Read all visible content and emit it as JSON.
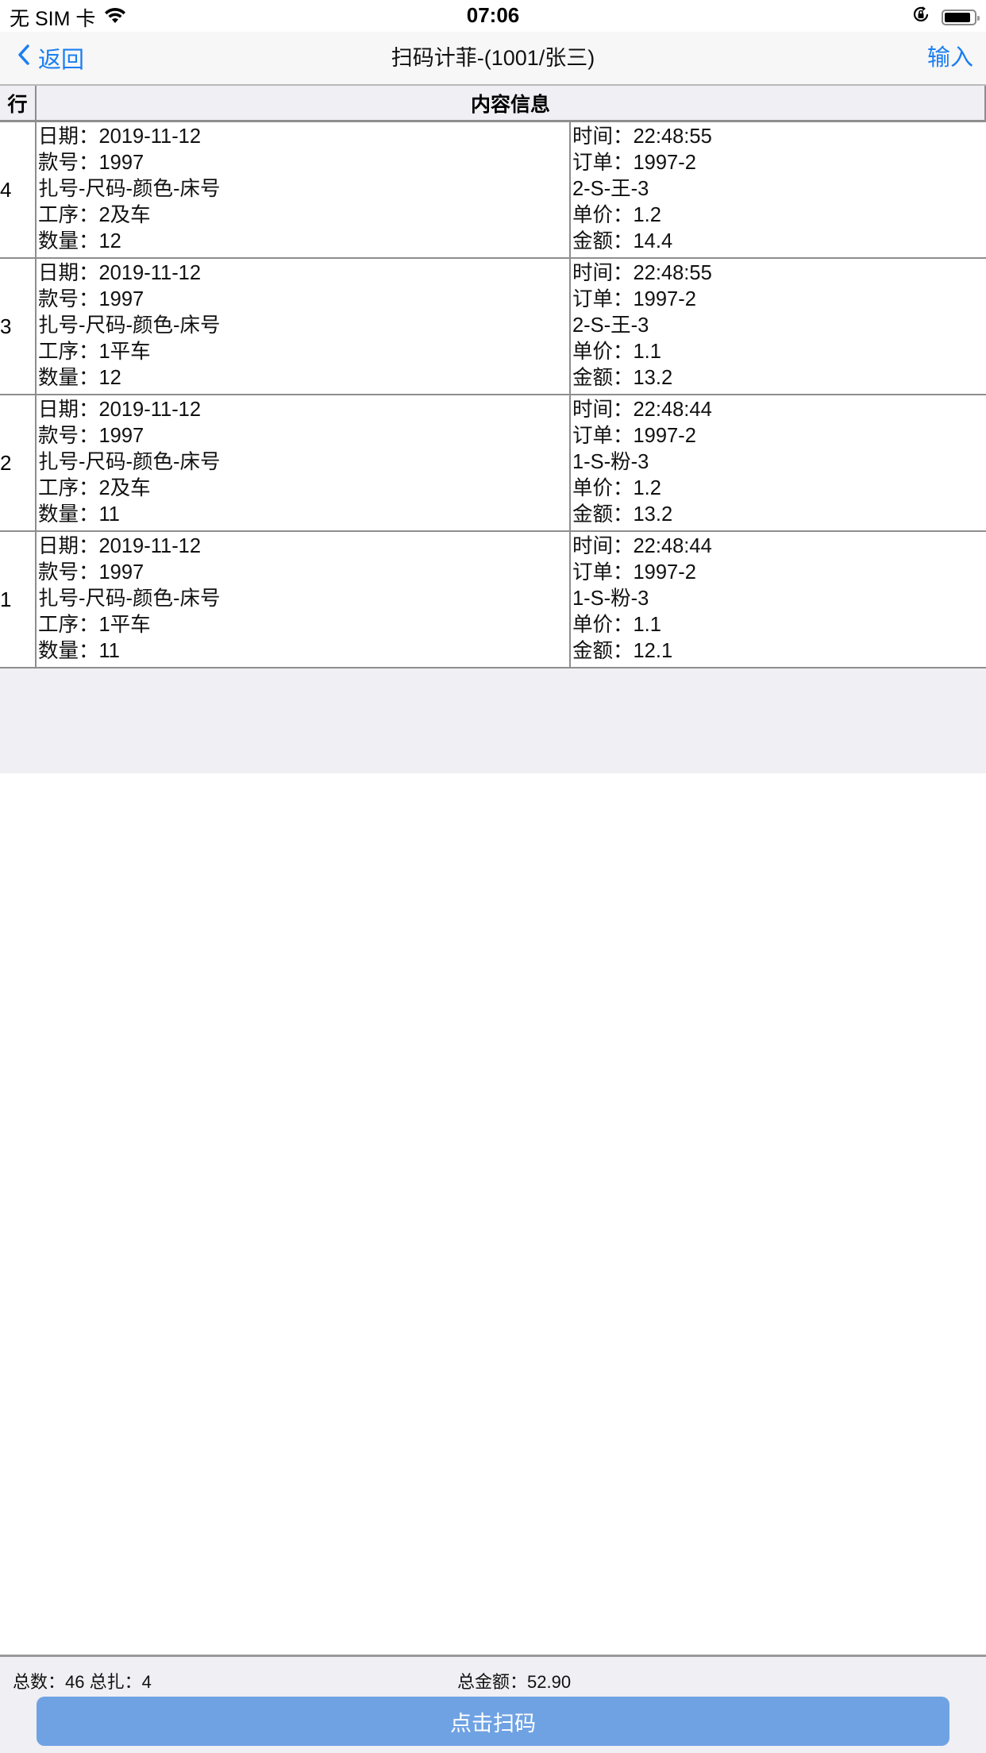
{
  "status_bar": {
    "carrier": "无 SIM 卡",
    "time": "07:06",
    "battery_level": 0.9
  },
  "nav": {
    "back_label": "返回",
    "title": "扫码计菲-(1001/张三)",
    "input_label": "输入"
  },
  "table": {
    "headers": {
      "row": "行",
      "content": "内容信息"
    },
    "rows": [
      {
        "num": "4",
        "left": [
          "日期：2019-11-12",
          "款号：1997",
          "扎号-尺码-颜色-床号",
          "工序：2及车",
          "数量：12"
        ],
        "right": [
          "时间：22:48:55",
          "订单：1997-2",
          "2-S-王-3",
          "单价：1.2",
          "金额：14.4"
        ]
      },
      {
        "num": "3",
        "left": [
          "日期：2019-11-12",
          "款号：1997",
          "扎号-尺码-颜色-床号",
          "工序：1平车",
          "数量：12"
        ],
        "right": [
          "时间：22:48:55",
          "订单：1997-2",
          "2-S-王-3",
          "单价：1.1",
          "金额：13.2"
        ]
      },
      {
        "num": "2",
        "left": [
          "日期：2019-11-12",
          "款号：1997",
          "扎号-尺码-颜色-床号",
          "工序：2及车",
          "数量：11"
        ],
        "right": [
          "时间：22:48:44",
          "订单：1997-2",
          "1-S-粉-3",
          "单价：1.2",
          "金额：13.2"
        ]
      },
      {
        "num": "1",
        "left": [
          "日期：2019-11-12",
          "款号：1997",
          "扎号-尺码-颜色-床号",
          "工序：1平车",
          "数量：11"
        ],
        "right": [
          "时间：22:48:44",
          "订单：1997-2",
          "1-S-粉-3",
          "单价：1.1",
          "金额：12.1"
        ]
      }
    ]
  },
  "footer": {
    "totals_left": "总数：46 总扎：4",
    "totals_amount": "总金额：52.90",
    "scan_button_label": "点击扫码"
  },
  "colors": {
    "accent": "#1a7ef2",
    "button": "#6fa2e3",
    "panel_gray": "#efeff4"
  }
}
